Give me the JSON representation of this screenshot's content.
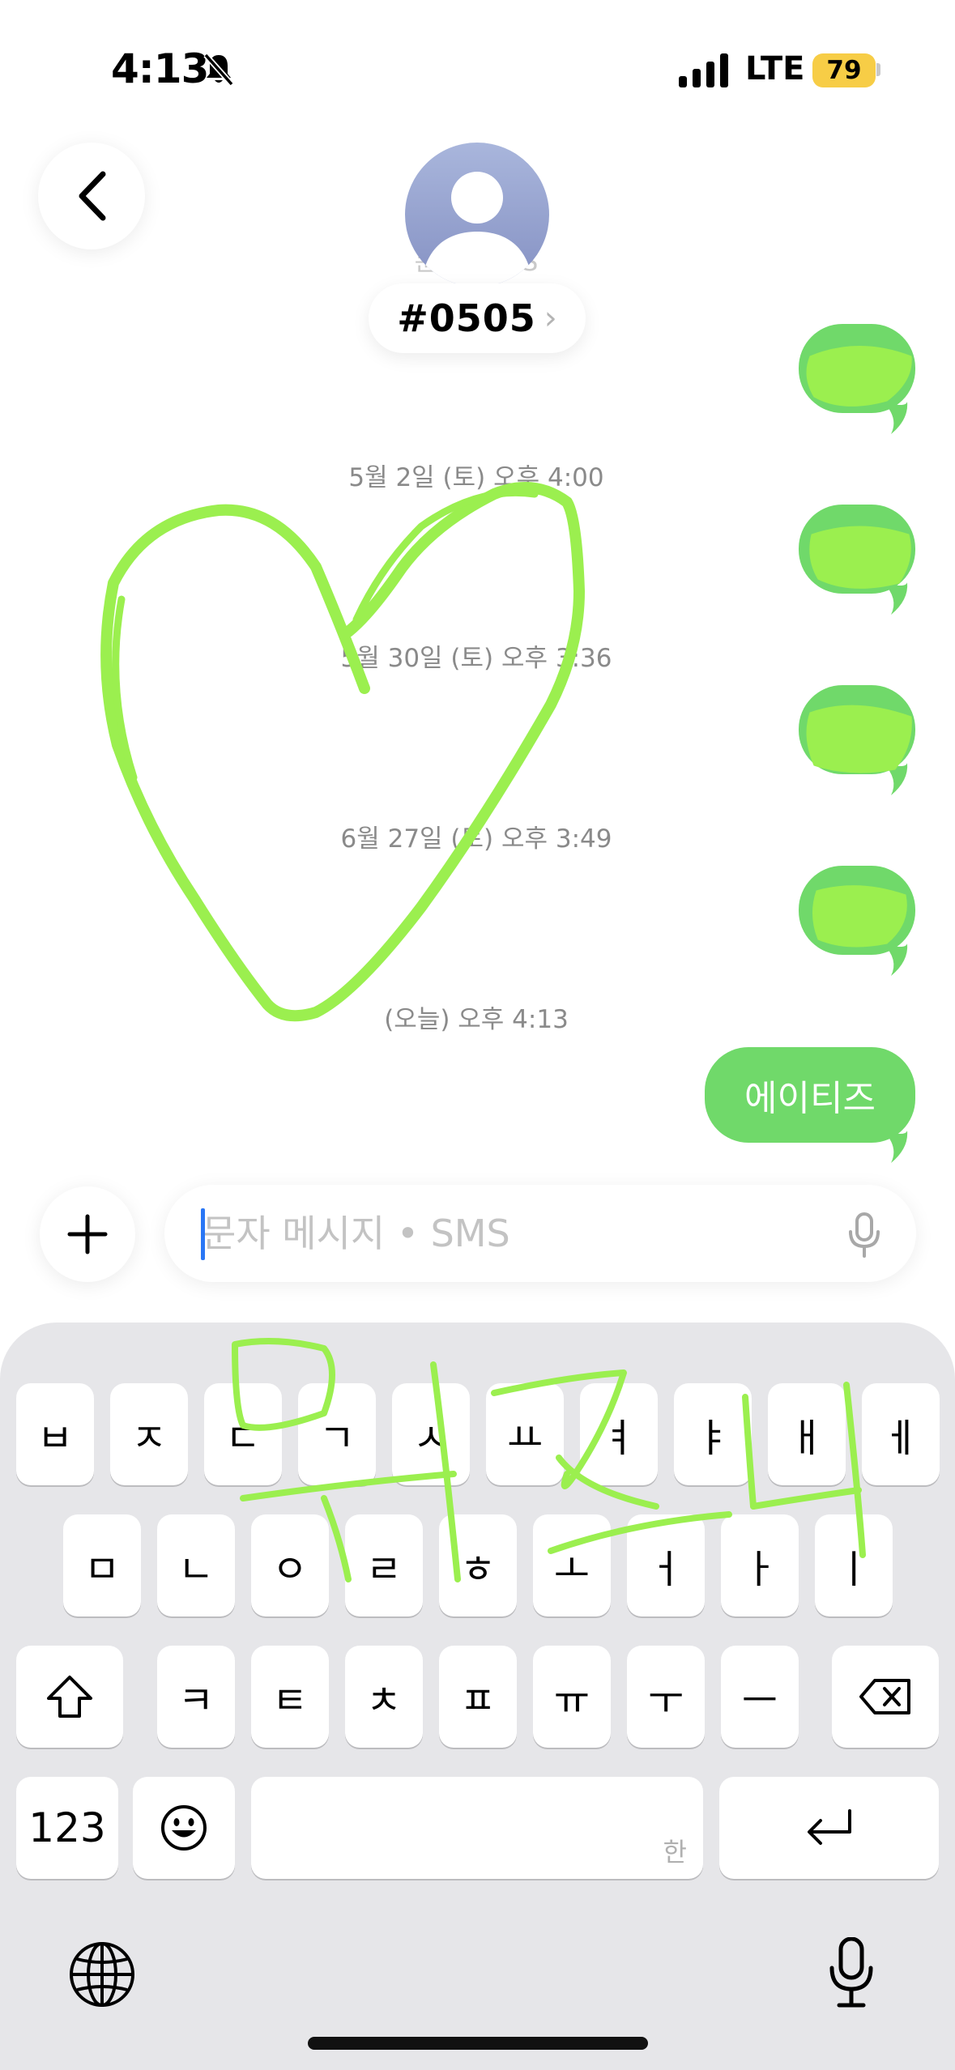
{
  "status_bar": {
    "time": "4:13",
    "network": "LTE",
    "battery": "79"
  },
  "header": {
    "ghost_line1": "문자 · SMS",
    "ghost_line2": "4월 · 3:07",
    "contact_name": "#0505",
    "contact_chevron": "›"
  },
  "timestamps": [
    "5월 2일 (토) 오후 4:00",
    "5월 30일 (토) 오후 3:36",
    "6월 27일 (토) 오후 3:49",
    "(오늘) 오후 4:13"
  ],
  "messages": [
    {
      "text": "",
      "scribbled": true
    },
    {
      "text": "",
      "scribbled": true
    },
    {
      "text": "",
      "scribbled": true
    },
    {
      "text": "",
      "scribbled": true
    },
    {
      "text": "에이티즈",
      "scribbled": false
    }
  ],
  "composer": {
    "placeholder": "문자 메시지 • SMS"
  },
  "keyboard": {
    "row1": [
      "ㅂ",
      "ㅈ",
      "ㄷ",
      "ㄱ",
      "ㅅ",
      "ㅛ",
      "ㅕ",
      "ㅑ",
      "ㅐ",
      "ㅔ"
    ],
    "row2": [
      "ㅁ",
      "ㄴ",
      "ㅇ",
      "ㄹ",
      "ㅎ",
      "ㅗ",
      "ㅓ",
      "ㅏ",
      "ㅣ"
    ],
    "row3": [
      "ㅋ",
      "ㅌ",
      "ㅊ",
      "ㅍ",
      "ㅠ",
      "ㅜ",
      "ㅡ"
    ],
    "numbers_label": "123",
    "space_hint": "한"
  },
  "colors": {
    "bubble": "#70d96a",
    "scribble": "#9bef4f",
    "battery": "#f7cd46",
    "caret": "#2a77f5"
  },
  "icons": [
    "bell-slash-icon",
    "signal-icon",
    "back-chevron-icon",
    "person-icon",
    "plus-icon",
    "microphone-icon",
    "shift-icon",
    "backspace-icon",
    "emoji-icon",
    "return-icon",
    "globe-icon"
  ]
}
